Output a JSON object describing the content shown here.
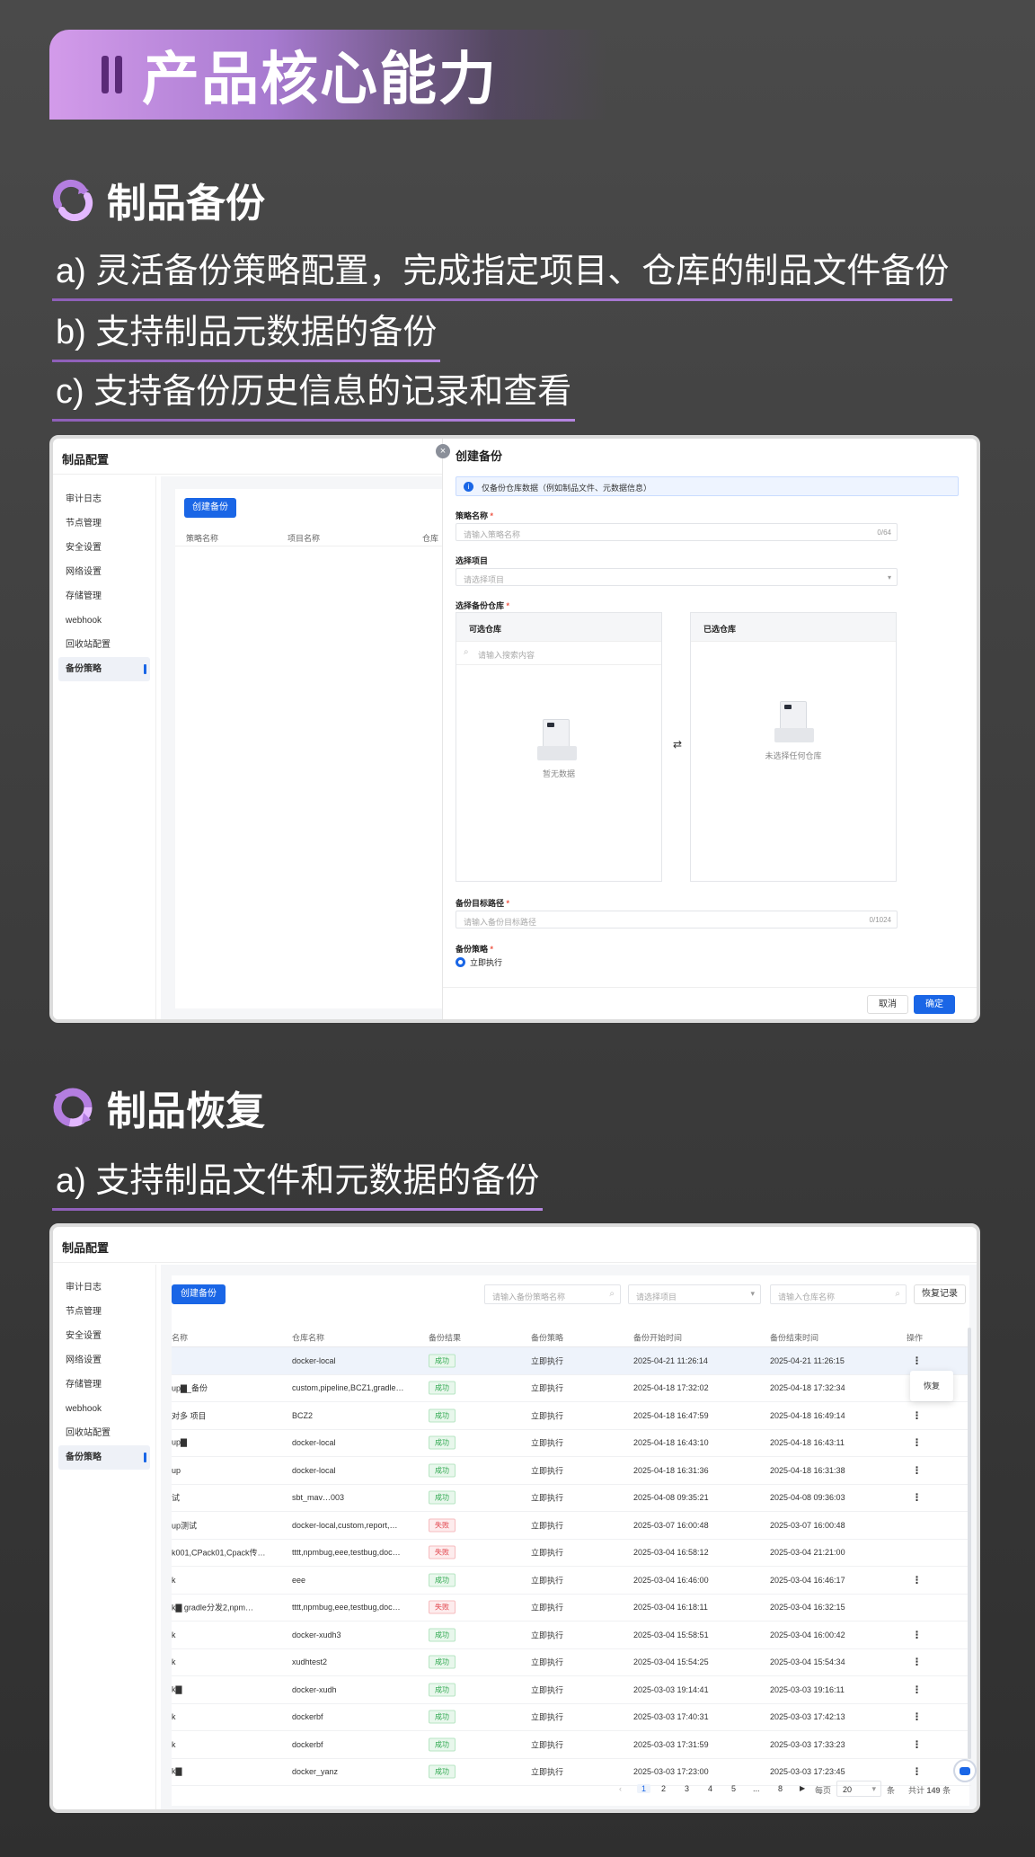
{
  "banner": {
    "title": "产品核心能力"
  },
  "section1": {
    "title": "制品备份",
    "bullets": [
      "a)  灵活备份策略配置，完成指定项目、仓库的制品文件备份",
      "b)  支持制品元数据的备份",
      "c)  支持备份历史信息的记录和查看"
    ]
  },
  "section2": {
    "title": "制品恢复",
    "bullets": [
      "a)  支持制品文件和元数据的备份"
    ]
  },
  "app": {
    "title": "制品配置",
    "sidebar": [
      "审计日志",
      "节点管理",
      "安全设置",
      "网络设置",
      "存储管理",
      "webhook",
      "回收站配置",
      "备份策略"
    ]
  },
  "shot1": {
    "create_button": "创建备份",
    "columns": [
      "策略名称",
      "项目名称",
      "仓库"
    ],
    "dialog": {
      "title": "创建备份",
      "notice": "仅备份仓库数据（例如制品文件、元数据信息）",
      "name_label": "策略名称",
      "name_placeholder": "请输入策略名称",
      "name_count": "0/64",
      "project_label": "选择项目",
      "project_placeholder": "请选择项目",
      "repo_label": "选择备份仓库",
      "available_title": "可选仓库",
      "search_placeholder": "请输入搜索内容",
      "available_empty": "暂无数据",
      "selected_title": "已选仓库",
      "selected_empty": "未选择任何仓库",
      "path_label": "备份目标路径",
      "path_placeholder": "请输入备份目标路径",
      "path_count": "0/1024",
      "strategy_label": "备份策略",
      "strategy_option": "立即执行",
      "cancel": "取消",
      "confirm": "确定"
    }
  },
  "shot2": {
    "create_button": "创建备份",
    "search_name_placeholder": "请输入备份策略名称",
    "project_select_placeholder": "请选择项目",
    "repo_search_placeholder": "请输入仓库名称",
    "restore_log_button": "恢复记录",
    "columns": [
      "名称",
      "仓库名称",
      "备份结果",
      "备份策略",
      "备份开始时间",
      "备份结束时间",
      "操作"
    ],
    "menu_item": "恢复",
    "rows": [
      {
        "name": "",
        "repo": "docker-local",
        "result": "成功",
        "ok": true,
        "strategy": "立即执行",
        "start": "2025-04-21 11:26:14",
        "end": "2025-04-21 11:26:15",
        "op": "⋮"
      },
      {
        "name": "up▇_备份",
        "repo": "custom,pipeline,BCZ1,gradle…",
        "result": "成功",
        "ok": true,
        "strategy": "立即执行",
        "start": "2025-04-18 17:32:02",
        "end": "2025-04-18 17:32:34",
        "op": ""
      },
      {
        "name": "对多 项目",
        "repo": "BCZ2",
        "result": "成功",
        "ok": true,
        "strategy": "立即执行",
        "start": "2025-04-18 16:47:59",
        "end": "2025-04-18 16:49:14",
        "op": "⋮"
      },
      {
        "name": "up▇",
        "repo": "docker-local",
        "result": "成功",
        "ok": true,
        "strategy": "立即执行",
        "start": "2025-04-18 16:43:10",
        "end": "2025-04-18 16:43:11",
        "op": "⋮"
      },
      {
        "name": "up",
        "repo": "docker-local",
        "result": "成功",
        "ok": true,
        "strategy": "立即执行",
        "start": "2025-04-18 16:31:36",
        "end": "2025-04-18 16:31:38",
        "op": "⋮"
      },
      {
        "name": "试",
        "repo": "sbt_mav…003",
        "result": "成功",
        "ok": true,
        "strategy": "立即执行",
        "start": "2025-04-08 09:35:21",
        "end": "2025-04-08 09:36:03",
        "op": "⋮"
      },
      {
        "name": "up测试",
        "repo": "docker-local,custom,report,…",
        "result": "失败",
        "ok": false,
        "strategy": "立即执行",
        "start": "2025-03-07 16:00:48",
        "end": "2025-03-07 16:00:48",
        "op": ""
      },
      {
        "name": "k001,CPack01,Cpack传…",
        "repo": "tttt,npmbug,eee,testbug,doc…",
        "result": "失败",
        "ok": false,
        "strategy": "立即执行",
        "start": "2025-03-04 16:58:12",
        "end": "2025-03-04 21:21:00",
        "op": ""
      },
      {
        "name": "k",
        "repo": "eee",
        "result": "成功",
        "ok": true,
        "strategy": "立即执行",
        "start": "2025-03-04 16:46:00",
        "end": "2025-03-04 16:46:17",
        "op": "⋮"
      },
      {
        "name": "k▇ gradle分发2,npm…",
        "repo": "tttt,npmbug,eee,testbug,doc…",
        "result": "失败",
        "ok": false,
        "strategy": "立即执行",
        "start": "2025-03-04 16:18:11",
        "end": "2025-03-04 16:32:15",
        "op": ""
      },
      {
        "name": "k",
        "repo": "docker-xudh3",
        "result": "成功",
        "ok": true,
        "strategy": "立即执行",
        "start": "2025-03-04 15:58:51",
        "end": "2025-03-04 16:00:42",
        "op": "⋮"
      },
      {
        "name": "k",
        "repo": "xudhtest2",
        "result": "成功",
        "ok": true,
        "strategy": "立即执行",
        "start": "2025-03-04 15:54:25",
        "end": "2025-03-04 15:54:34",
        "op": "⋮"
      },
      {
        "name": "k▇",
        "repo": "docker-xudh",
        "result": "成功",
        "ok": true,
        "strategy": "立即执行",
        "start": "2025-03-03 19:14:41",
        "end": "2025-03-03 19:16:11",
        "op": "⋮"
      },
      {
        "name": "k",
        "repo": "dockerbf",
        "result": "成功",
        "ok": true,
        "strategy": "立即执行",
        "start": "2025-03-03 17:40:31",
        "end": "2025-03-03 17:42:13",
        "op": "⋮"
      },
      {
        "name": "k",
        "repo": "dockerbf",
        "result": "成功",
        "ok": true,
        "strategy": "立即执行",
        "start": "2025-03-03 17:31:59",
        "end": "2025-03-03 17:33:23",
        "op": "⋮"
      },
      {
        "name": "k▇",
        "repo": "docker_yanz",
        "result": "成功",
        "ok": true,
        "strategy": "立即执行",
        "start": "2025-03-03 17:23:00",
        "end": "2025-03-03 17:23:45",
        "op": "⋮"
      }
    ],
    "pager": {
      "pages": [
        "1",
        "2",
        "3",
        "4",
        "5",
        "...",
        "8"
      ],
      "per_page_label": "每页",
      "per_page": "20",
      "unit": "条",
      "total_label": "共计",
      "total": "149",
      "total_unit": "条"
    }
  }
}
